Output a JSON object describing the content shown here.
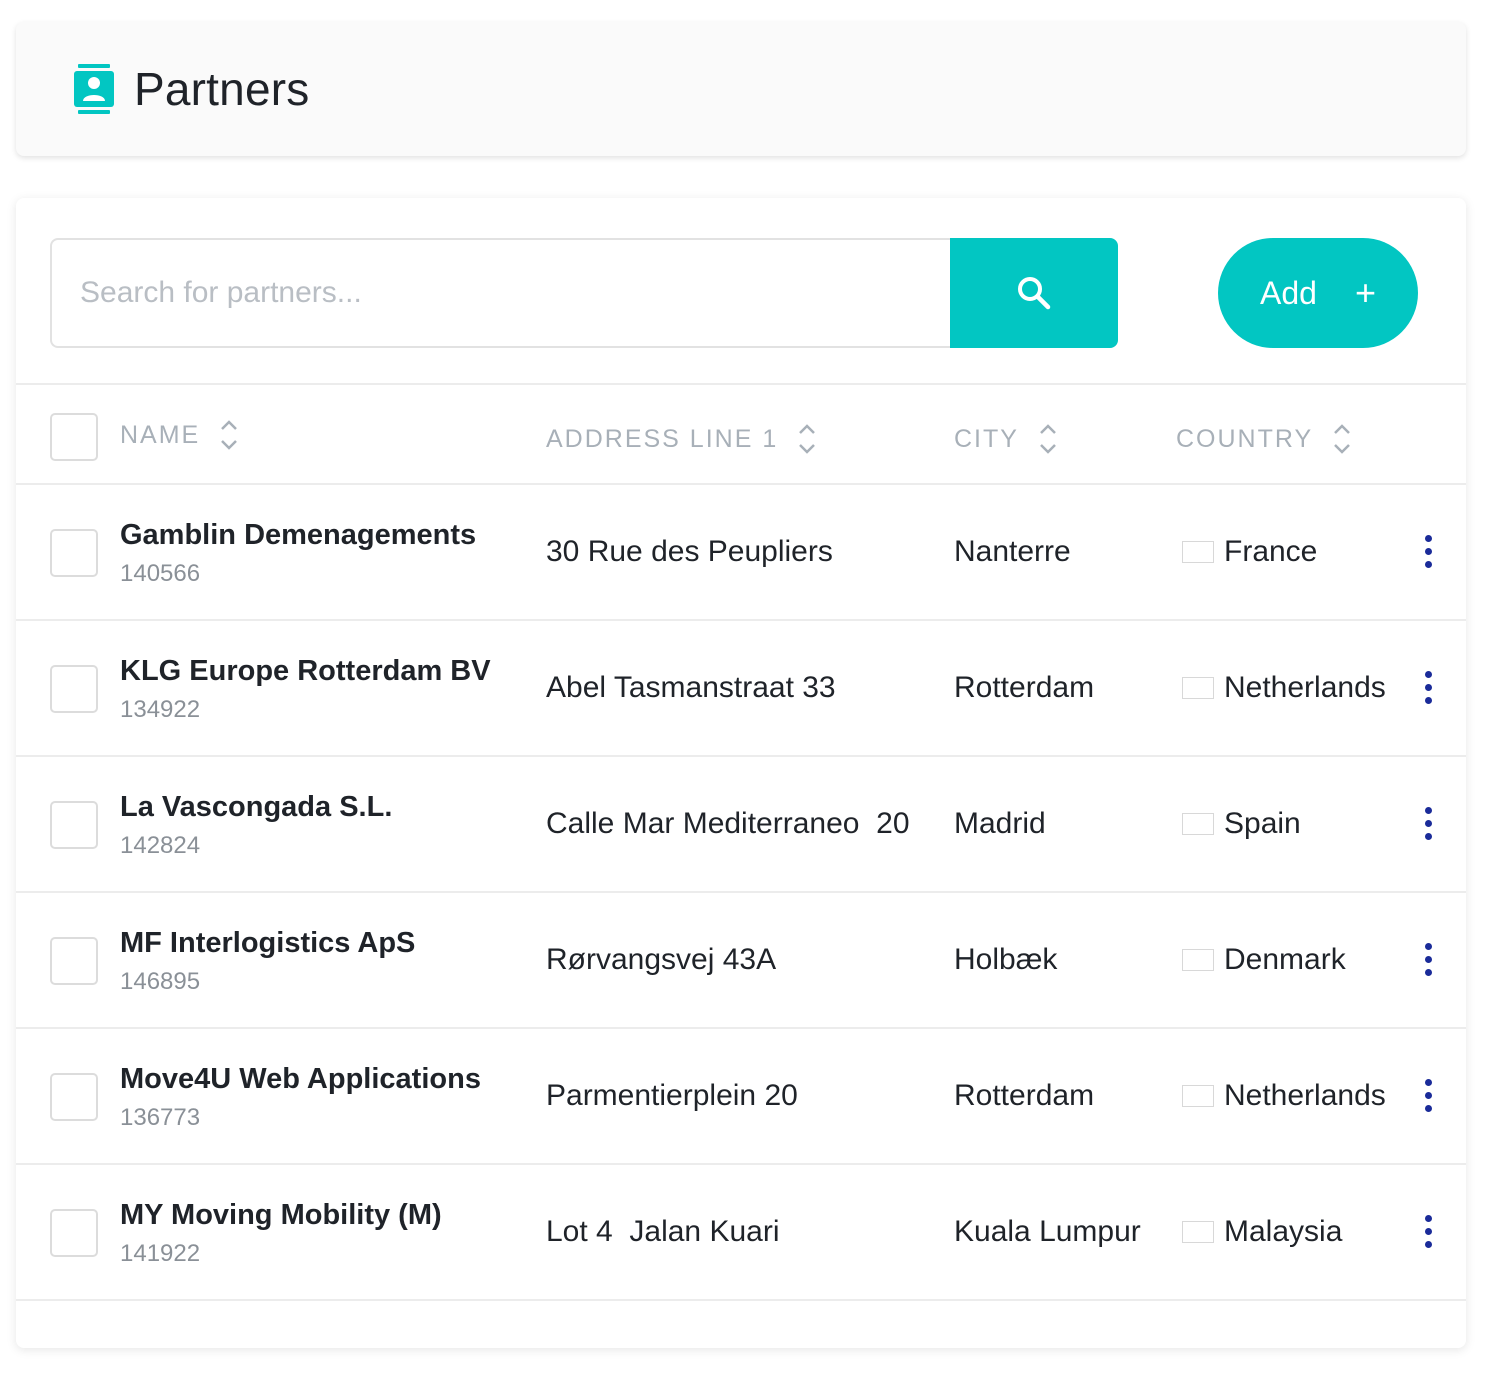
{
  "header": {
    "title": "Partners",
    "icon": "contact-card-icon"
  },
  "search": {
    "placeholder": "Search for partners...",
    "value": ""
  },
  "actions": {
    "add_label": "Add",
    "add_icon": "+"
  },
  "colors": {
    "accent": "#02c6c2",
    "menu_dots": "#1a2b99"
  },
  "table": {
    "columns": [
      {
        "key": "name",
        "label": "NAME"
      },
      {
        "key": "address",
        "label": "ADDRESS LINE 1"
      },
      {
        "key": "city",
        "label": "CITY"
      },
      {
        "key": "country",
        "label": "COUNTRY"
      }
    ],
    "rows": [
      {
        "name": "Gamblin Demenagements",
        "id": "140566",
        "address": "30 Rue des Peupliers",
        "city": "Nanterre",
        "country": "France",
        "flag": "fr"
      },
      {
        "name": "KLG Europe Rotterdam BV",
        "id": "134922",
        "address": "Abel Tasmanstraat 33",
        "city": "Rotterdam",
        "country": "Netherlands",
        "flag": "nl"
      },
      {
        "name": "La Vascongada S.L.",
        "id": "142824",
        "address": "Calle Mar Mediterraneo  20",
        "city": "Madrid",
        "country": "Spain",
        "flag": "es"
      },
      {
        "name": "MF Interlogistics ApS",
        "id": "146895",
        "address": "Rørvangsvej 43A",
        "city": "Holbæk",
        "country": "Denmark",
        "flag": "dk"
      },
      {
        "name": "Move4U Web Applications",
        "id": "136773",
        "address": "Parmentierplein 20",
        "city": "Rotterdam",
        "country": "Netherlands",
        "flag": "nl"
      },
      {
        "name": "MY Moving Mobility (M)",
        "id": "141922",
        "address": "Lot 4  Jalan Kuari",
        "city": "Kuala Lumpur",
        "country": "Malaysia",
        "flag": "my"
      }
    ]
  }
}
